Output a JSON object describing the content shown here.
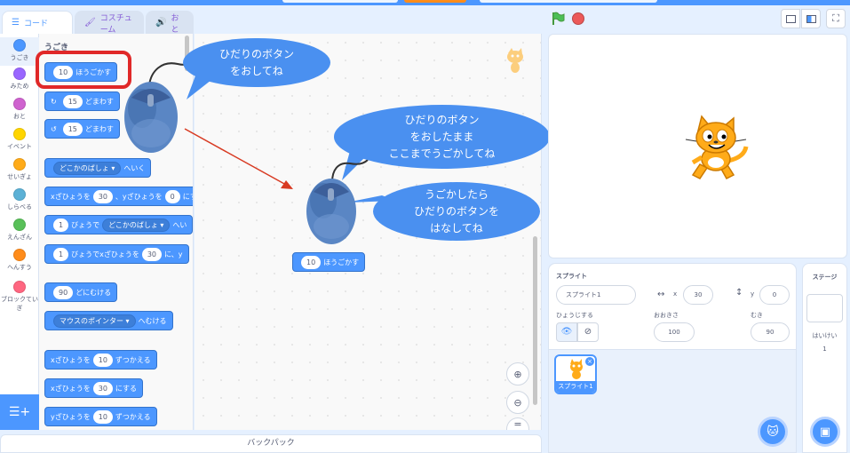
{
  "tabs": [
    {
      "label": "コード",
      "icon": "code-icon"
    },
    {
      "label": "コスチューム",
      "icon": "brush-icon"
    },
    {
      "label": "おと",
      "icon": "speaker-icon"
    }
  ],
  "categories": [
    {
      "label": "うごき",
      "color": "#4c97ff"
    },
    {
      "label": "みため",
      "color": "#9966ff"
    },
    {
      "label": "おと",
      "color": "#cf63cf"
    },
    {
      "label": "イベント",
      "color": "#ffd500"
    },
    {
      "label": "せいぎょ",
      "color": "#ffab19"
    },
    {
      "label": "しらべる",
      "color": "#5cb1d6"
    },
    {
      "label": "えんざん",
      "color": "#59c059"
    },
    {
      "label": "へんすう",
      "color": "#ff8c1a"
    },
    {
      "label": "ブロックていぎ",
      "color": "#ff6680"
    }
  ],
  "flyout": {
    "section_title": "うごき",
    "blocks": {
      "move": {
        "value": "10",
        "text": "ほうごかす"
      },
      "turn_right": {
        "value": "15",
        "text": "どまわす"
      },
      "turn_left": {
        "value": "15",
        "text": "どまわす"
      },
      "goto": {
        "dropdown": "どこかのばしょ",
        "text": "へいく"
      },
      "goto_xy": {
        "t1": "xざひょうを",
        "x": "30",
        "t2": "、yざひょうを",
        "y": "0",
        "t3": "にする"
      },
      "glide": {
        "sec": "1",
        "t1": "びょうで",
        "dropdown": "どこかのばしょ",
        "t2": "へい"
      },
      "glide_xy": {
        "sec": "1",
        "t1": "びょうでxざひょうを",
        "x": "30",
        "t2": "に、y"
      },
      "point_dir": {
        "value": "90",
        "text": "どにむける"
      },
      "point_towards": {
        "dropdown": "マウスのポインター",
        "text": "へむける"
      },
      "change_x": {
        "t1": "xざひょうを",
        "value": "10",
        "t2": "ずつかえる"
      },
      "set_x": {
        "t1": "xざひょうを",
        "value": "30",
        "t2": "にする"
      },
      "change_y": {
        "t1": "yざひょうを",
        "value": "10",
        "t2": "ずつかえる"
      }
    }
  },
  "workspace": {
    "dragged_block": {
      "value": "10",
      "text": "ほうごかす"
    },
    "bubbles": {
      "b1": [
        "ひだりのボタン",
        "をおしてね"
      ],
      "b2": [
        "ひだりのボタン",
        "をおしたまま",
        "ここまでうごかしてね"
      ],
      "b3": [
        "うごかしたら",
        "ひだりのボタンを",
        "はなしてね"
      ]
    }
  },
  "backpack": "バックパック",
  "sprite_info": {
    "heading": "スプライト",
    "name": "スプライト1",
    "x_label": "x",
    "x": "30",
    "y_label": "y",
    "y": "0",
    "show_label": "ひょうじする",
    "size_label": "おおきさ",
    "size": "100",
    "dir_label": "むき",
    "direction": "90"
  },
  "sprite_thumb": "スプライト1",
  "stage_pane": {
    "heading": "ステージ",
    "bg_label": "はいけい",
    "bg_count": "1"
  },
  "colors": {
    "accent": "#4c97ff",
    "highlight": "#e02828",
    "bubble": "#4a90f0"
  }
}
